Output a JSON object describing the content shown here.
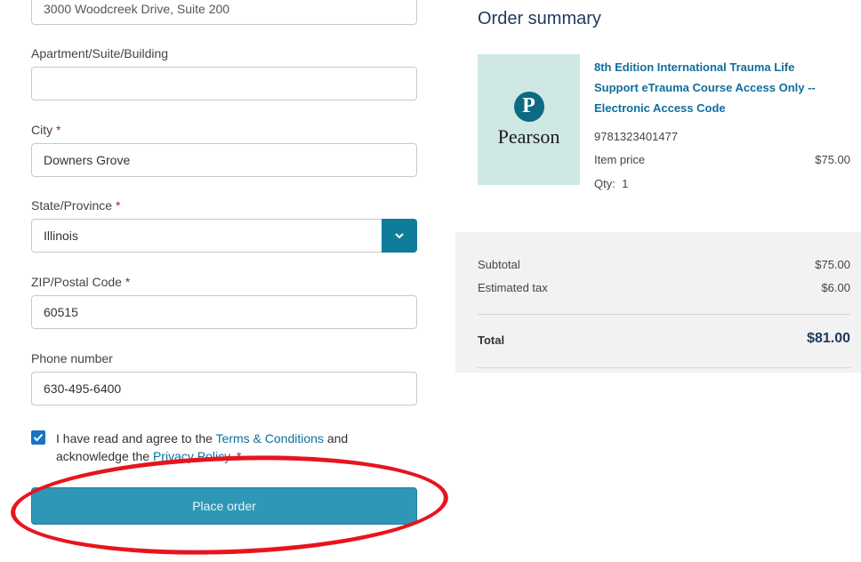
{
  "form": {
    "address_line1_value": "3000 Woodcreek Drive, Suite 200",
    "apartment_label": "Apartment/Suite/Building",
    "apartment_value": "",
    "city_label": "City",
    "city_value": "Downers Grove",
    "state_label": "State/Province",
    "state_value": "Illinois",
    "zip_label": "ZIP/Postal Code",
    "zip_value": "60515",
    "phone_label": "Phone number",
    "phone_value": "630-495-6400",
    "required_mark": "*",
    "consent_prefix": "I have read and agree to the ",
    "terms_link": "Terms & Conditions",
    "consent_middle": " and acknowledge the ",
    "privacy_link": "Privacy Policy",
    "consent_suffix": ". *",
    "consent_checked": true,
    "place_order_label": "Place order"
  },
  "summary": {
    "title": "Order summary",
    "brand": "Pearson",
    "product_title": "8th Edition International Trauma Life Support eTrauma Course Access Only -- Electronic Access Code",
    "isbn": "9781323401477",
    "item_price_label": "Item price",
    "item_price_value": "$75.00",
    "qty_label": "Qty:",
    "qty_value": "1",
    "subtotal_label": "Subtotal",
    "subtotal_value": "$75.00",
    "tax_label": "Estimated tax",
    "tax_value": "$6.00",
    "total_label": "Total",
    "total_value": "$81.00"
  },
  "colors": {
    "accent": "#0f7c9c",
    "button": "#2f97b6",
    "link": "#0f6e9c",
    "required": "#9e1b6b",
    "annotation": "#e8141d"
  },
  "icons": {
    "select_chevron": "chevron-down-icon",
    "checkbox": "checkmark-icon",
    "logo": "pearson-logo-icon"
  }
}
